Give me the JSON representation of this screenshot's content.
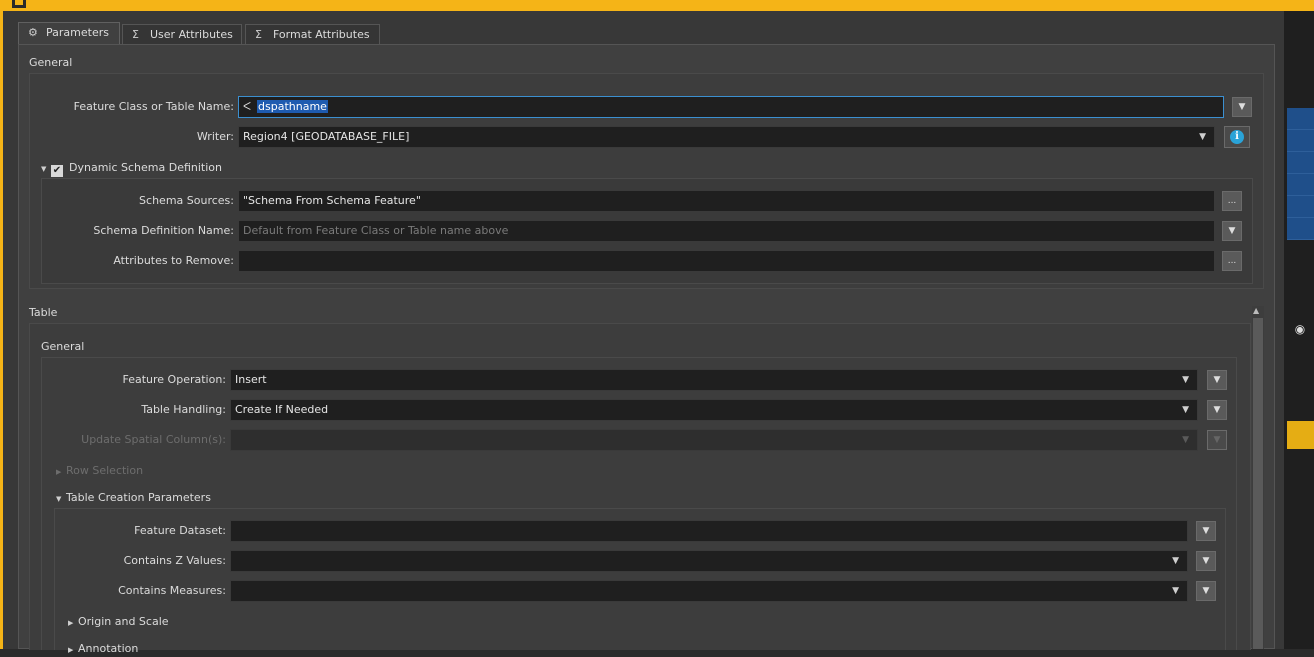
{
  "tabs": [
    {
      "label": "Parameters",
      "icon": "gear-icon"
    },
    {
      "label": "User Attributes",
      "icon": "sigma-icon"
    },
    {
      "label": "Format Attributes",
      "icon": "sigma-icon"
    }
  ],
  "general": {
    "title": "General",
    "feature_class_label": "Feature Class or Table Name:",
    "feature_class_value": "dspathname",
    "writer_label": "Writer:",
    "writer_value": "Region4 [GEODATABASE_FILE]",
    "dynamic_schema_label": "Dynamic Schema Definition",
    "dynamic_schema_checked": true,
    "schema_sources_label": "Schema Sources:",
    "schema_sources_value": "\"Schema From Schema Feature\"",
    "schema_def_name_label": "Schema Definition Name:",
    "schema_def_name_placeholder": "Default from Feature Class or Table name above",
    "attrs_remove_label": "Attributes to Remove:",
    "attrs_remove_value": ""
  },
  "table": {
    "title": "Table",
    "general_title": "General",
    "feature_operation_label": "Feature Operation:",
    "feature_operation_value": "Insert",
    "table_handling_label": "Table Handling:",
    "table_handling_value": "Create If Needed",
    "update_spatial_label": "Update Spatial Column(s):",
    "row_selection_label": "Row Selection",
    "table_creation_label": "Table Creation Parameters",
    "feature_dataset_label": "Feature Dataset:",
    "contains_z_label": "Contains Z Values:",
    "contains_measures_label": "Contains Measures:",
    "origin_scale_label": "Origin and Scale",
    "annotation_label": "Annotation"
  },
  "buttons": {
    "ellipsis": "...",
    "info": "i"
  },
  "colors": {
    "accent_yellow": "#f5b417",
    "focus_blue": "#3b8fd0",
    "info_blue": "#2aa3d8"
  }
}
